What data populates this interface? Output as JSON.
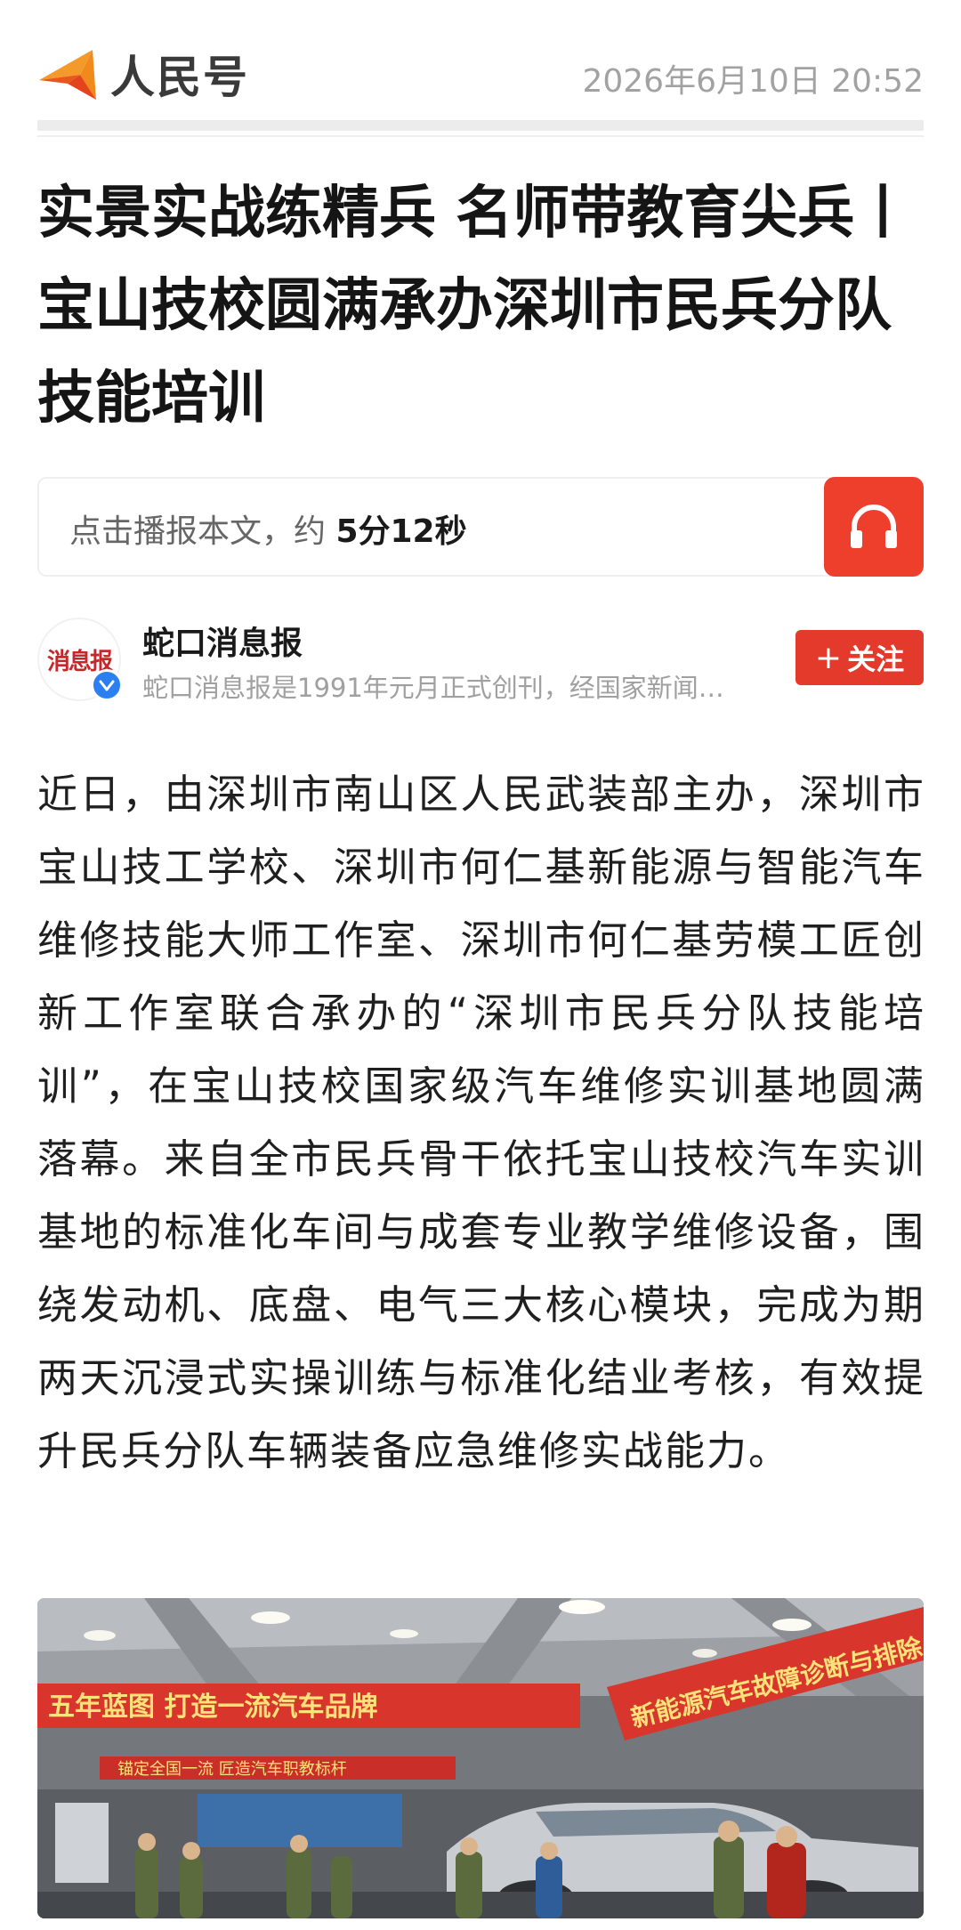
{
  "header": {
    "logo_text": "人民号",
    "datetime": "2026年6月10日 20:52"
  },
  "article": {
    "title": "实景实战练精兵 名师带教育尖兵丨宝山技校圆满承办深圳市民兵分队技能培训",
    "body": "近日，由深圳市南山区人民武装部主办，深圳市宝山技工学校、深圳市何仁基新能源与智能汽车维修技能大师工作室、深圳市何仁基劳模工匠创新工作室联合承办的“深圳市民兵分队技能培训”，在宝山技校国家级汽车维修实训基地圆满落幕。来自全市民兵骨干依托宝山技校汽车实训基地的标准化车间与成套专业教学维修设备，围绕发动机、底盘、电气三大核心模块，完成为期两天沉浸式实操训练与标准化结业考核，有效提升民兵分队车辆装备应急维修实战能力。"
  },
  "audio": {
    "prompt": "点击播报本文，约 ",
    "duration": "5分12秒",
    "icon": "headphones-icon"
  },
  "author": {
    "name": "蛇口消息报",
    "description": "蛇口消息报是1991年元月正式创刊，经国家新闻…",
    "avatar_text": "消息报",
    "follow_plus": "+",
    "follow_label": "关注"
  },
  "photo": {
    "banner_left": "五年蓝图 打造一流汽车品牌",
    "banner_right": "新能源汽车故障诊断与排除",
    "banner_small": "锚定全国一流 匠造汽车职教标杆"
  },
  "colors": {
    "accent_red": "#e33a2c",
    "audio_red": "#ee3f2d",
    "logo_orange": "#f08a1c",
    "verified_blue": "#2b7ff0"
  }
}
